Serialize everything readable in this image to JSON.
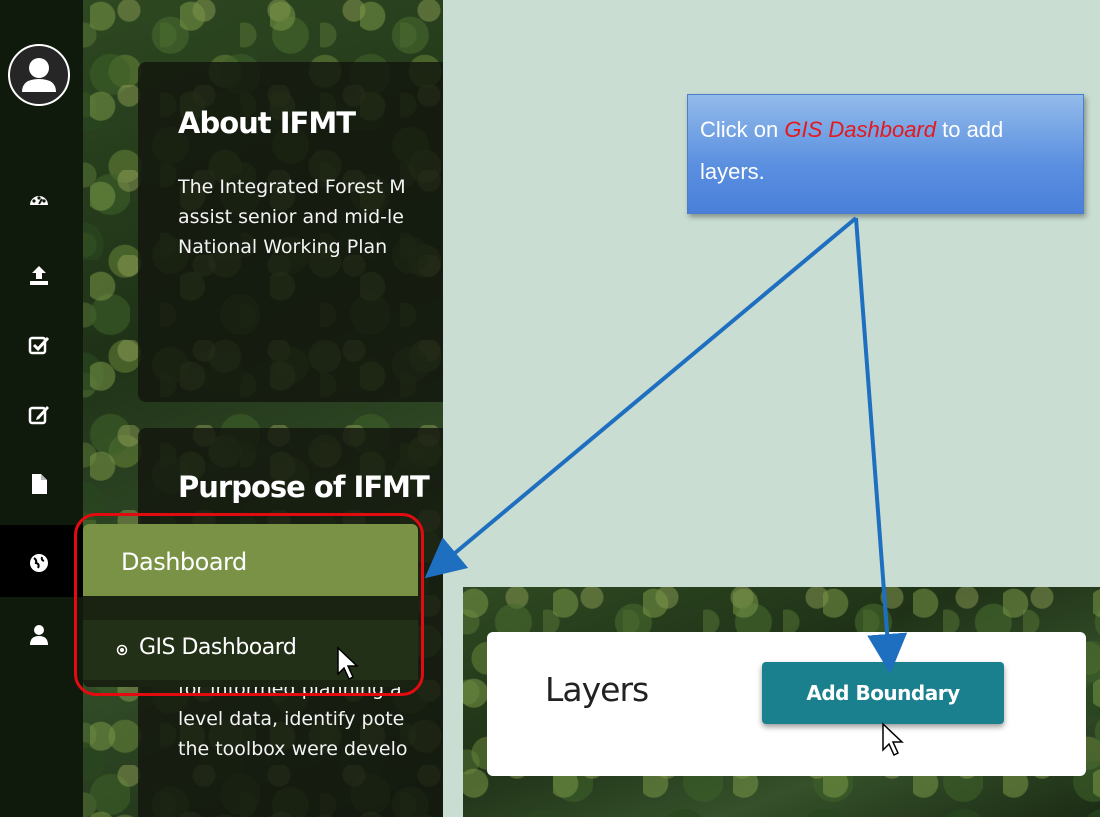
{
  "about": {
    "title": "About IFMT",
    "lines": [
      "The Integrated Forest M",
      "assist senior and mid-le",
      "National Working Plan"
    ]
  },
  "purpose": {
    "title": "Purpose of IFMT",
    "lines": [
      "for informed planning a",
      "level data, identify pote",
      "the toolbox were develo"
    ]
  },
  "menu": {
    "header": "Dashboard",
    "item": "GIS Dashboard"
  },
  "sidebar_icons": [
    "user-avatar-icon",
    "dashboard-gauge-icon",
    "upload-icon",
    "checkbox-icon",
    "edit-icon",
    "document-icon",
    "globe-icon",
    "user-icon"
  ],
  "layers": {
    "title": "Layers",
    "add_boundary": "Add Boundary"
  },
  "callout": {
    "prefix": "Click on ",
    "highlight": "GIS Dashboard",
    "suffix": " to add layers."
  },
  "colors": {
    "menu_header": "#7a9245",
    "add_boundary_button": "#1a808e",
    "highlight_box": "#e40b10",
    "callout": "#5a8fe0",
    "arrow": "#1f6fc0"
  }
}
